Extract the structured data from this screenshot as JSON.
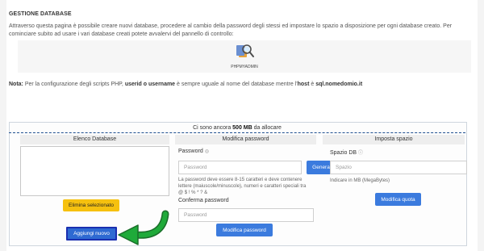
{
  "header": {
    "title": "GESTIONE DATABASE",
    "intro": "Attraverso questa pagina è possibile creare nuovi database, procedere al cambio della password degli stessi ed impostare lo spazio a disposizione per ogni database creato. Per cominciare subito ad usare i vari database creati potete avvalervi del pannello di controllo:"
  },
  "phpmyadmin": {
    "label": "PHPMYADMIN",
    "icon": "phpmyadmin-icon"
  },
  "note": {
    "prefix": "Nota:",
    "text1": " Per la configurazione degli scripts PHP, ",
    "bold1": "userid o username",
    "text2": " è sempre uguale al nome del database mentre l'",
    "bold2": "host",
    "text3": " è ",
    "bold3": "sql.nomedomio.it"
  },
  "allocation": {
    "prefix": "Ci sono ancora ",
    "amount": "500 MB",
    "suffix": " da allocare"
  },
  "database_list": {
    "header": "Elenco Database",
    "delete_label": "Elimina selezionato",
    "add_label": "Aggiungi nuovo"
  },
  "password_section": {
    "header": "Modifica password",
    "password_label": "Password",
    "password_placeholder": "Password",
    "generate_label": "Genera",
    "help": "La password deve essere 8-15 caratteri e deve contenere lettere (maiuscole/minuscole), numeri e caratteri speciali tra @ $ ! % * ? &",
    "confirm_label": "Conferma password",
    "confirm_placeholder": "Password",
    "submit_label": "Modifica password"
  },
  "space_section": {
    "header": "Imposta spazio",
    "label": "Spazio DB",
    "placeholder": "Spazio",
    "help": "Indicare in MB (MegaBytes)",
    "submit_label": "Modifica quota"
  },
  "colors": {
    "accent_blue": "#3b7bde",
    "warning_yellow": "#f6c10f",
    "arrow_green": "#1faa3a"
  }
}
